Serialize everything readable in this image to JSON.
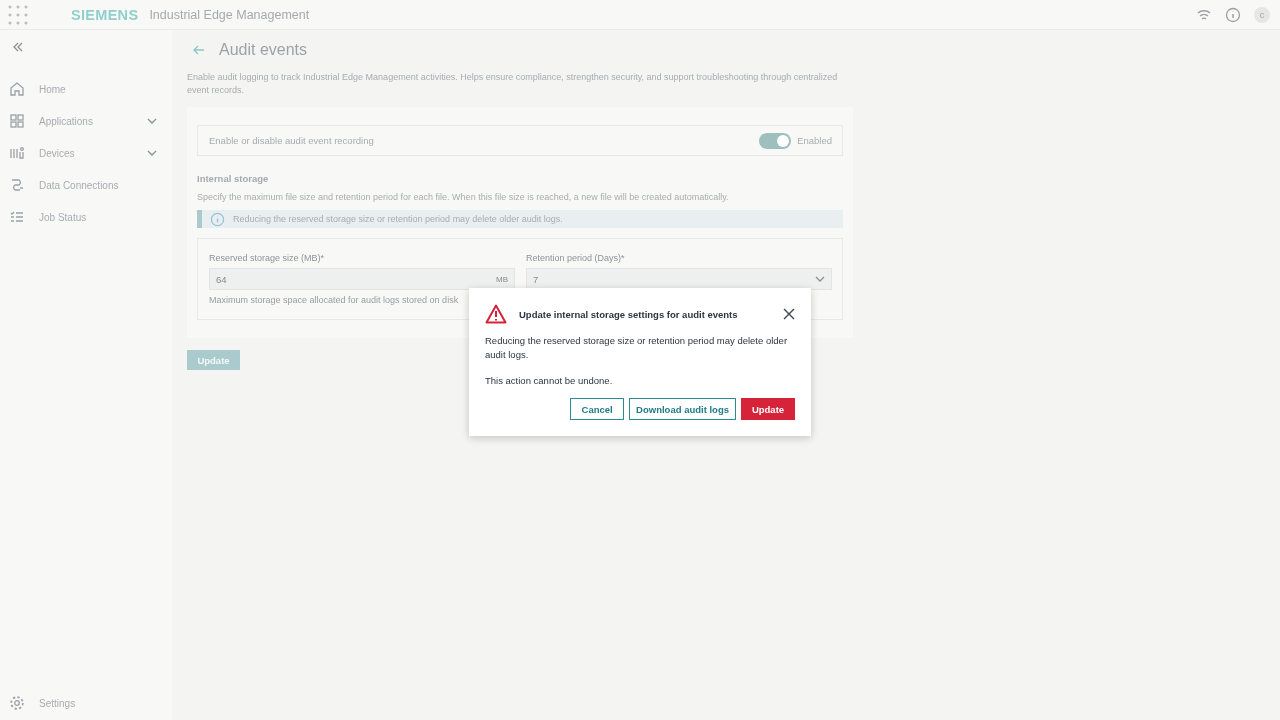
{
  "header": {
    "brand": "SIEMENS",
    "app_title": "Industrial Edge Management",
    "avatar": "c"
  },
  "sidebar": {
    "items": [
      {
        "label": "Home",
        "has_children": false
      },
      {
        "label": "Applications",
        "has_children": true
      },
      {
        "label": "Devices",
        "has_children": true
      },
      {
        "label": "Data Connections",
        "has_children": false
      },
      {
        "label": "Job Status",
        "has_children": false
      }
    ],
    "footer_item": {
      "label": "Settings"
    }
  },
  "page": {
    "title": "Audit events",
    "description": "Enable audit logging to track Industrial Edge Management activities. Helps ensure compliance, strengthen security, and support troubleshooting through centralized event records.",
    "recording": {
      "label": "Enable or disable audit event recording",
      "on": true,
      "state_label": "Enabled"
    },
    "storage": {
      "heading": "Internal storage",
      "description": "Specify the maximum file size and retention period for each file. When this file size is reached, a new file will be created automatically.",
      "info": "Reducing the reserved storage size or retention period may delete older audit logs.",
      "size_field": {
        "label": "Reserved storage size (MB)*",
        "value": "64",
        "unit": "MB",
        "helper": "Maximum storage space allocated for audit logs stored on disk"
      },
      "retention_field": {
        "label": "Retention period (Days)*",
        "value": "7"
      }
    },
    "update_button": "Update"
  },
  "dialog": {
    "title": "Update internal storage settings for audit events",
    "body": "Reducing the reserved storage size or retention period may delete older audit logs.",
    "note": "This action cannot be undone.",
    "buttons": [
      {
        "label": "Cancel",
        "kind": "secondary"
      },
      {
        "label": "Download audit logs",
        "kind": "secondary"
      },
      {
        "label": "Update",
        "kind": "danger"
      }
    ]
  }
}
